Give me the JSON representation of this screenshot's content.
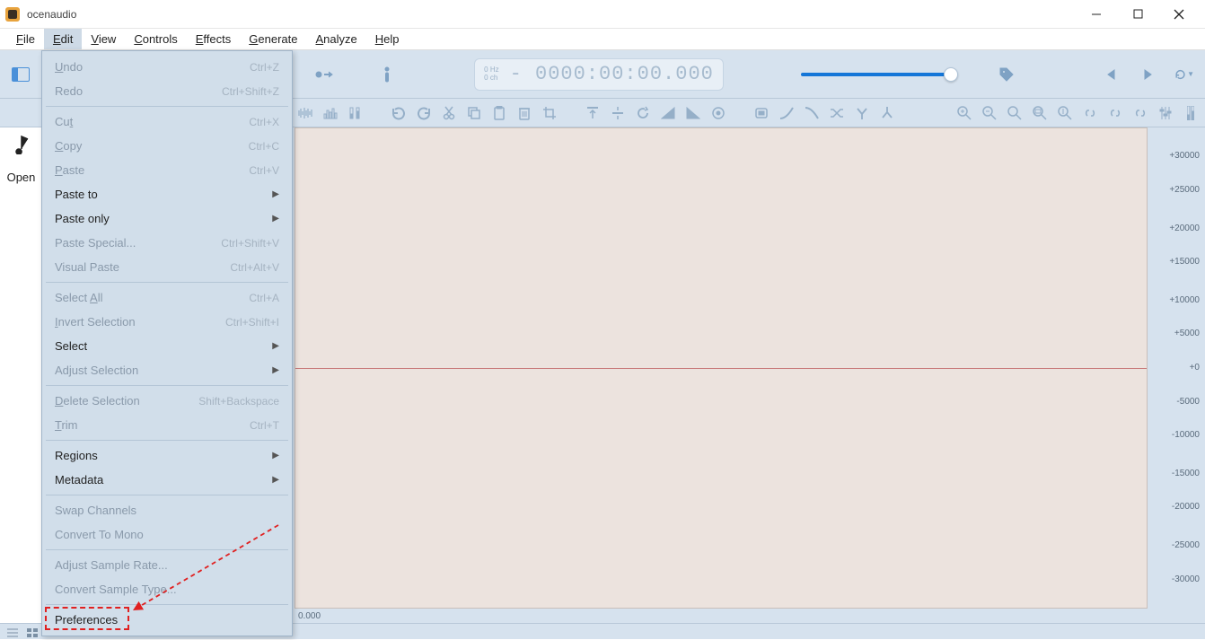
{
  "window": {
    "title": "ocenaudio"
  },
  "menubar": [
    "File",
    "Edit",
    "View",
    "Controls",
    "Effects",
    "Generate",
    "Analyze",
    "Help"
  ],
  "transport": {
    "meta_hz": "0 Hz",
    "meta_ch": "0 ch",
    "time": "- 0000:00:00.000"
  },
  "sidebar": {
    "text": "Open"
  },
  "timeline": {
    "start": "0.000"
  },
  "amp_ticks": [
    {
      "label": "+30000",
      "pct": 6
    },
    {
      "label": "+25000",
      "pct": 13
    },
    {
      "label": "+20000",
      "pct": 21
    },
    {
      "label": "+15000",
      "pct": 28
    },
    {
      "label": "+10000",
      "pct": 36
    },
    {
      "label": "+5000",
      "pct": 43
    },
    {
      "label": "+0",
      "pct": 50
    },
    {
      "label": "-5000",
      "pct": 57
    },
    {
      "label": "-10000",
      "pct": 64
    },
    {
      "label": "-15000",
      "pct": 72
    },
    {
      "label": "-20000",
      "pct": 79
    },
    {
      "label": "-25000",
      "pct": 87
    },
    {
      "label": "-30000",
      "pct": 94
    }
  ],
  "edit_menu": [
    {
      "type": "item",
      "label": "Undo",
      "shortcut": "Ctrl+Z",
      "enabled": false,
      "u": 0
    },
    {
      "type": "item",
      "label": "Redo",
      "shortcut": "Ctrl+Shift+Z",
      "enabled": false
    },
    {
      "type": "sep"
    },
    {
      "type": "item",
      "label": "Cut",
      "shortcut": "Ctrl+X",
      "enabled": false,
      "u": 2
    },
    {
      "type": "item",
      "label": "Copy",
      "shortcut": "Ctrl+C",
      "enabled": false,
      "u": 0
    },
    {
      "type": "item",
      "label": "Paste",
      "shortcut": "Ctrl+V",
      "enabled": false,
      "u": 0
    },
    {
      "type": "submenu",
      "label": "Paste to",
      "enabled": true
    },
    {
      "type": "submenu",
      "label": "Paste only",
      "enabled": true
    },
    {
      "type": "item",
      "label": "Paste Special...",
      "shortcut": "Ctrl+Shift+V",
      "enabled": false
    },
    {
      "type": "item",
      "label": "Visual Paste",
      "shortcut": "Ctrl+Alt+V",
      "enabled": false
    },
    {
      "type": "sep"
    },
    {
      "type": "item",
      "label": "Select All",
      "shortcut": "Ctrl+A",
      "enabled": false,
      "u": 7
    },
    {
      "type": "item",
      "label": "Invert Selection",
      "shortcut": "Ctrl+Shift+I",
      "enabled": false,
      "u": 0
    },
    {
      "type": "submenu",
      "label": "Select",
      "enabled": true
    },
    {
      "type": "submenu",
      "label": "Adjust Selection",
      "enabled": false
    },
    {
      "type": "sep"
    },
    {
      "type": "item",
      "label": "Delete Selection",
      "shortcut": "Shift+Backspace",
      "enabled": false,
      "u": 0
    },
    {
      "type": "item",
      "label": "Trim",
      "shortcut": "Ctrl+T",
      "enabled": false,
      "u": 0
    },
    {
      "type": "sep"
    },
    {
      "type": "submenu",
      "label": "Regions",
      "enabled": true
    },
    {
      "type": "submenu",
      "label": "Metadata",
      "enabled": true
    },
    {
      "type": "sep"
    },
    {
      "type": "item",
      "label": "Swap Channels",
      "enabled": false
    },
    {
      "type": "item",
      "label": "Convert To Mono",
      "enabled": false
    },
    {
      "type": "sep"
    },
    {
      "type": "item",
      "label": "Adjust Sample Rate...",
      "enabled": false
    },
    {
      "type": "item",
      "label": "Convert Sample Type...",
      "enabled": false
    },
    {
      "type": "sep"
    },
    {
      "type": "item",
      "label": "Preferences",
      "enabled": true
    }
  ]
}
